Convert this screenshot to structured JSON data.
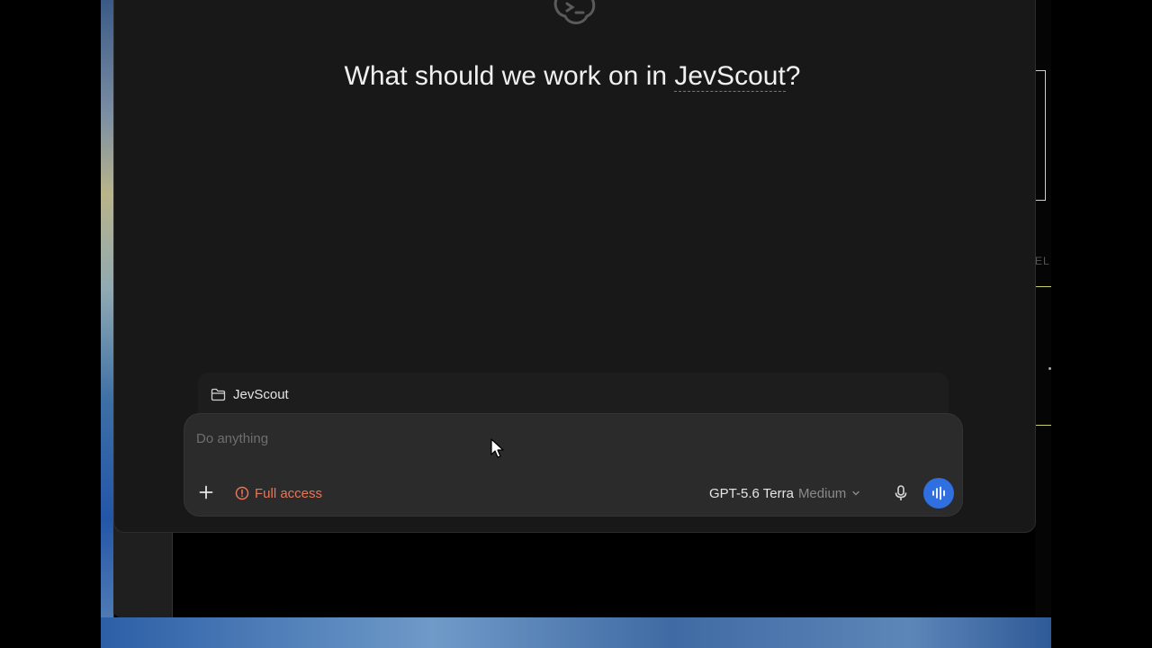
{
  "heading": {
    "prefix": "What should we work on in ",
    "project": "JevScout",
    "suffix": "?"
  },
  "project_chip": {
    "icon": "folder-icon",
    "label": "JevScout"
  },
  "composer": {
    "placeholder": "Do anything",
    "value": ""
  },
  "toolbar": {
    "add_icon": "plus-icon",
    "access_icon": "alert-circle-icon",
    "access_label": "Full access",
    "model_name": "GPT-5.6 Terra",
    "model_effort": "Medium",
    "dropdown_icon": "chevron-down-icon",
    "mic_icon": "microphone-icon",
    "voice_icon": "voice-waveform-icon"
  },
  "side_panel": {
    "label": "EL"
  },
  "colors": {
    "accent": "#2f6fe0",
    "warning": "#e8765a",
    "window_bg": "#181818",
    "composer_bg": "#2b2b2b"
  }
}
